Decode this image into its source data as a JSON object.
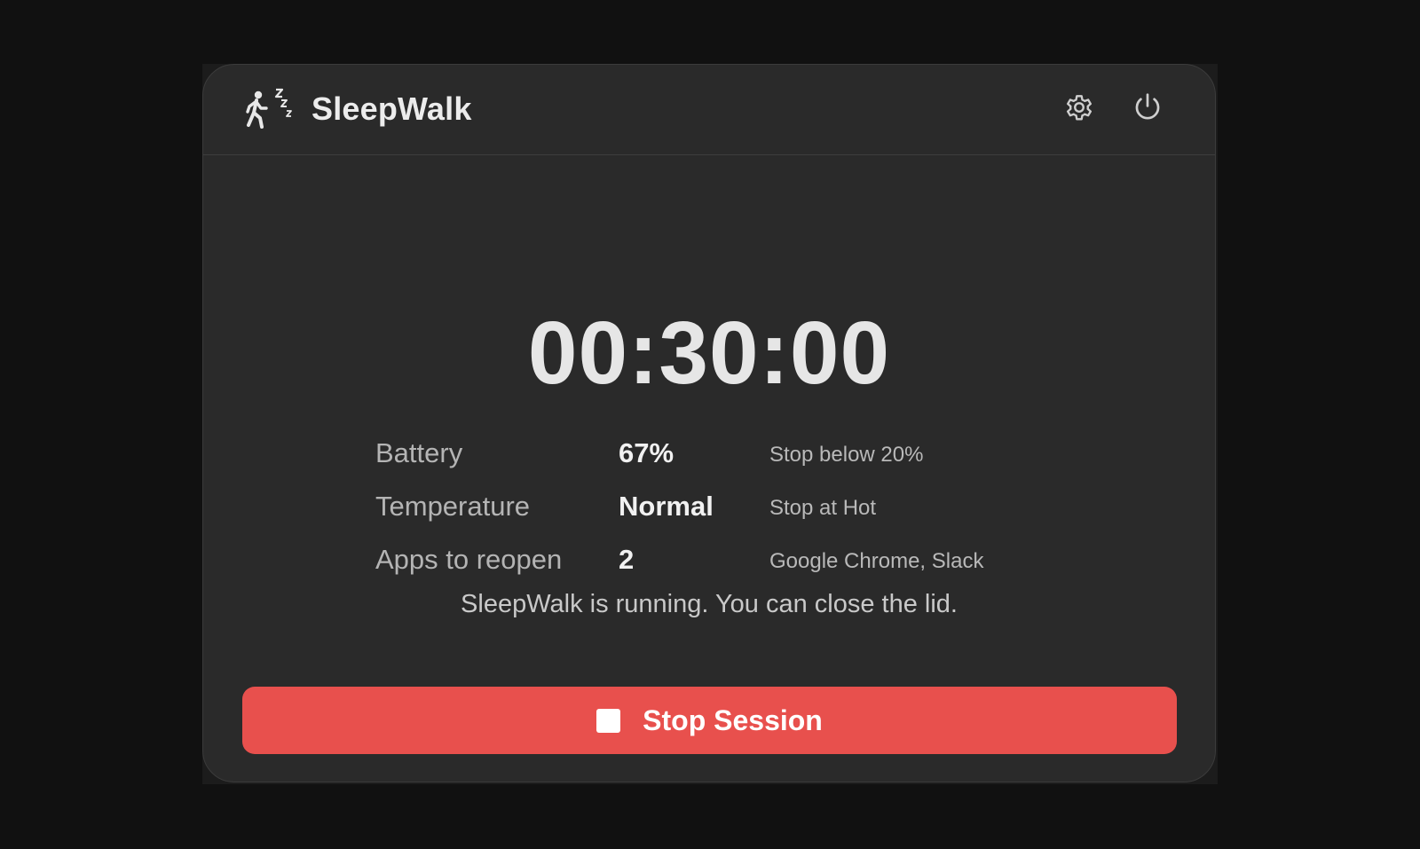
{
  "app": {
    "title": "SleepWalk",
    "logo_icon": "walking-person-zzz-icon"
  },
  "header": {
    "settings_icon": "gear-icon",
    "power_icon": "power-icon"
  },
  "timer": {
    "display": "00:30:00"
  },
  "stats": [
    {
      "label": "Battery",
      "value": "67%",
      "note": "Stop below 20%"
    },
    {
      "label": "Temperature",
      "value": "Normal",
      "note": "Stop at Hot"
    },
    {
      "label": "Apps to reopen",
      "value": "2",
      "note": "Google Chrome, Slack"
    }
  ],
  "status": {
    "message": "SleepWalk is running. You can close the lid."
  },
  "actions": {
    "stop_label": "Stop Session",
    "stop_icon": "stop-square-icon"
  },
  "colors": {
    "background": "#111111",
    "panel": "#2a2a2a",
    "accent_red": "#e8504d",
    "text_primary": "#f1f1f1",
    "text_secondary": "#b4b4b4"
  }
}
